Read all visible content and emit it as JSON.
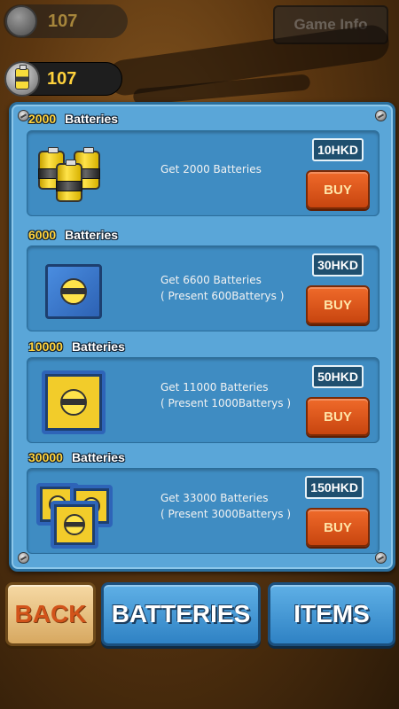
{
  "background": {
    "counter_value": "107",
    "game_info_label": "Game Info"
  },
  "header": {
    "battery_count": "107"
  },
  "shop": {
    "packs": [
      {
        "amount": "2000",
        "unit": "Batteries",
        "description_line1": "Get 2000 Batteries",
        "description_line2": "",
        "price": "10HKD",
        "buy_label": "BUY",
        "art": "battery-stack-icon"
      },
      {
        "amount": "6000",
        "unit": "Batteries",
        "description_line1": "Get 6600 Batteries",
        "description_line2": "( Present 600Batterys )",
        "price": "30HKD",
        "buy_label": "BUY",
        "art": "battery-box-icon"
      },
      {
        "amount": "10000",
        "unit": "Batteries",
        "description_line1": "Get 11000 Batteries",
        "description_line2": "( Present 1000Batterys )",
        "price": "50HKD",
        "buy_label": "BUY",
        "art": "battery-crate-icon"
      },
      {
        "amount": "30000",
        "unit": "Batteries",
        "description_line1": "Get 33000 Batteries",
        "description_line2": "( Present 3000Batterys )",
        "price": "150HKD",
        "buy_label": "BUY",
        "art": "battery-crates-icon"
      }
    ]
  },
  "nav": {
    "back_label": "BACK",
    "batteries_label": "BATTERIES",
    "items_label": "ITEMS"
  },
  "colors": {
    "panel": "#5aa6d8",
    "card": "#3f8cc2",
    "buy_button": "#e0561c",
    "price_tag": "#1f4f6f",
    "amount_text": "#ffd23c"
  }
}
